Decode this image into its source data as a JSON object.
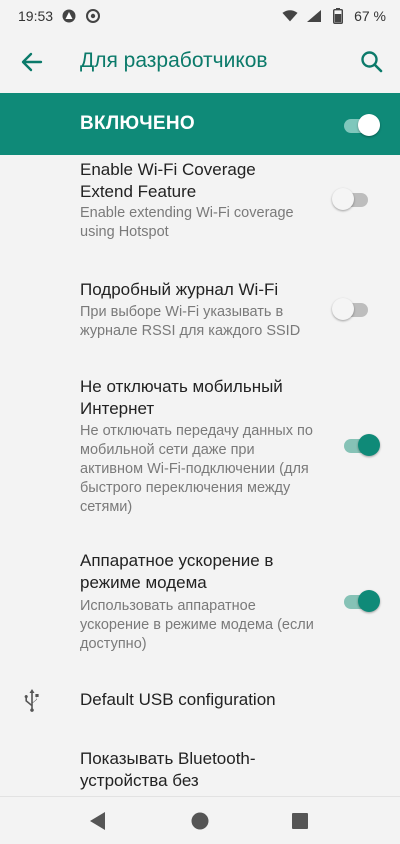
{
  "status_bar": {
    "time": "19:53",
    "battery_percent": "67 %",
    "left_icons": [
      "android-system-icon",
      "sync-app-icon"
    ],
    "right_icons": [
      "wifi-icon",
      "signal-icon",
      "battery-icon"
    ]
  },
  "app_bar": {
    "title": "Для разработчиков",
    "back_icon": "arrow-back-icon",
    "search_icon": "search-icon"
  },
  "master_switch": {
    "label": "ВКЛЮЧЕНО",
    "checked": true
  },
  "settings": [
    {
      "title": "Enable Wi-Fi Coverage Extend Feature",
      "summary": "Enable extending Wi-Fi coverage using Hotspot",
      "checked": false
    },
    {
      "title": "Подробный журнал Wi-Fi",
      "summary": "При выборе Wi-Fi указывать в журнале RSSI для каждого SSID",
      "checked": false
    },
    {
      "title": "Не отключать мобильный Интернет",
      "summary": "Не отключать передачу данных по мобильной сети даже при активном Wi-Fi-подключении (для быстрого переключения между сетями)",
      "checked": true
    },
    {
      "title": "Аппаратное ускорение в режиме модема",
      "summary": "Использовать аппаратное ускорение в режиме модема (если доступно)",
      "checked": true
    },
    {
      "title": "Default USB configuration",
      "icon": "usb-icon"
    },
    {
      "title": "Показывать Bluetooth-устройства без"
    }
  ],
  "colors": {
    "accent": "#0f8a78",
    "accent_text": "#0b7a6a",
    "background": "#f3f3f3"
  },
  "nav_bar": {
    "icons": [
      "back-triangle-icon",
      "home-circle-icon",
      "recents-square-icon"
    ]
  }
}
